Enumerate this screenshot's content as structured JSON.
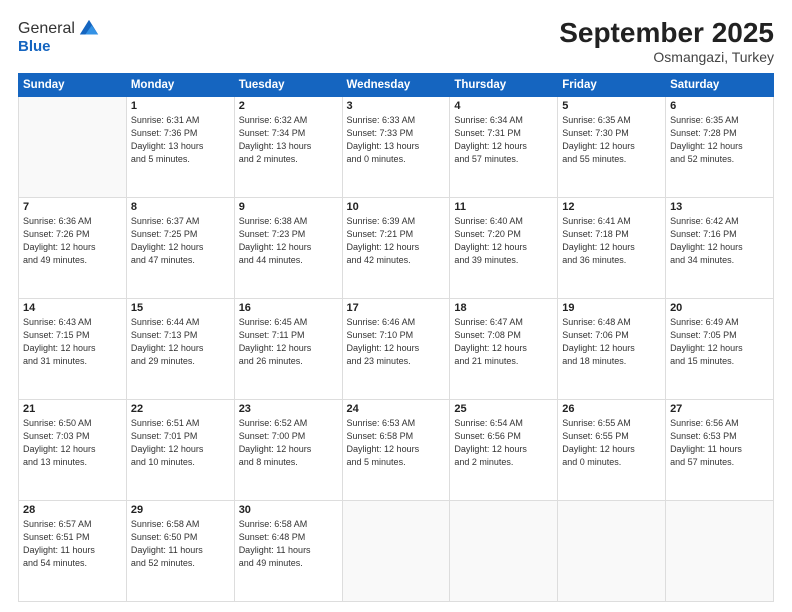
{
  "header": {
    "logo_line1": "General",
    "logo_line2": "Blue",
    "title": "September 2025",
    "subtitle": "Osmangazi, Turkey"
  },
  "days_of_week": [
    "Sunday",
    "Monday",
    "Tuesday",
    "Wednesday",
    "Thursday",
    "Friday",
    "Saturday"
  ],
  "weeks": [
    [
      {
        "day": "",
        "info": ""
      },
      {
        "day": "1",
        "info": "Sunrise: 6:31 AM\nSunset: 7:36 PM\nDaylight: 13 hours\nand 5 minutes."
      },
      {
        "day": "2",
        "info": "Sunrise: 6:32 AM\nSunset: 7:34 PM\nDaylight: 13 hours\nand 2 minutes."
      },
      {
        "day": "3",
        "info": "Sunrise: 6:33 AM\nSunset: 7:33 PM\nDaylight: 13 hours\nand 0 minutes."
      },
      {
        "day": "4",
        "info": "Sunrise: 6:34 AM\nSunset: 7:31 PM\nDaylight: 12 hours\nand 57 minutes."
      },
      {
        "day": "5",
        "info": "Sunrise: 6:35 AM\nSunset: 7:30 PM\nDaylight: 12 hours\nand 55 minutes."
      },
      {
        "day": "6",
        "info": "Sunrise: 6:35 AM\nSunset: 7:28 PM\nDaylight: 12 hours\nand 52 minutes."
      }
    ],
    [
      {
        "day": "7",
        "info": "Sunrise: 6:36 AM\nSunset: 7:26 PM\nDaylight: 12 hours\nand 49 minutes."
      },
      {
        "day": "8",
        "info": "Sunrise: 6:37 AM\nSunset: 7:25 PM\nDaylight: 12 hours\nand 47 minutes."
      },
      {
        "day": "9",
        "info": "Sunrise: 6:38 AM\nSunset: 7:23 PM\nDaylight: 12 hours\nand 44 minutes."
      },
      {
        "day": "10",
        "info": "Sunrise: 6:39 AM\nSunset: 7:21 PM\nDaylight: 12 hours\nand 42 minutes."
      },
      {
        "day": "11",
        "info": "Sunrise: 6:40 AM\nSunset: 7:20 PM\nDaylight: 12 hours\nand 39 minutes."
      },
      {
        "day": "12",
        "info": "Sunrise: 6:41 AM\nSunset: 7:18 PM\nDaylight: 12 hours\nand 36 minutes."
      },
      {
        "day": "13",
        "info": "Sunrise: 6:42 AM\nSunset: 7:16 PM\nDaylight: 12 hours\nand 34 minutes."
      }
    ],
    [
      {
        "day": "14",
        "info": "Sunrise: 6:43 AM\nSunset: 7:15 PM\nDaylight: 12 hours\nand 31 minutes."
      },
      {
        "day": "15",
        "info": "Sunrise: 6:44 AM\nSunset: 7:13 PM\nDaylight: 12 hours\nand 29 minutes."
      },
      {
        "day": "16",
        "info": "Sunrise: 6:45 AM\nSunset: 7:11 PM\nDaylight: 12 hours\nand 26 minutes."
      },
      {
        "day": "17",
        "info": "Sunrise: 6:46 AM\nSunset: 7:10 PM\nDaylight: 12 hours\nand 23 minutes."
      },
      {
        "day": "18",
        "info": "Sunrise: 6:47 AM\nSunset: 7:08 PM\nDaylight: 12 hours\nand 21 minutes."
      },
      {
        "day": "19",
        "info": "Sunrise: 6:48 AM\nSunset: 7:06 PM\nDaylight: 12 hours\nand 18 minutes."
      },
      {
        "day": "20",
        "info": "Sunrise: 6:49 AM\nSunset: 7:05 PM\nDaylight: 12 hours\nand 15 minutes."
      }
    ],
    [
      {
        "day": "21",
        "info": "Sunrise: 6:50 AM\nSunset: 7:03 PM\nDaylight: 12 hours\nand 13 minutes."
      },
      {
        "day": "22",
        "info": "Sunrise: 6:51 AM\nSunset: 7:01 PM\nDaylight: 12 hours\nand 10 minutes."
      },
      {
        "day": "23",
        "info": "Sunrise: 6:52 AM\nSunset: 7:00 PM\nDaylight: 12 hours\nand 8 minutes."
      },
      {
        "day": "24",
        "info": "Sunrise: 6:53 AM\nSunset: 6:58 PM\nDaylight: 12 hours\nand 5 minutes."
      },
      {
        "day": "25",
        "info": "Sunrise: 6:54 AM\nSunset: 6:56 PM\nDaylight: 12 hours\nand 2 minutes."
      },
      {
        "day": "26",
        "info": "Sunrise: 6:55 AM\nSunset: 6:55 PM\nDaylight: 12 hours\nand 0 minutes."
      },
      {
        "day": "27",
        "info": "Sunrise: 6:56 AM\nSunset: 6:53 PM\nDaylight: 11 hours\nand 57 minutes."
      }
    ],
    [
      {
        "day": "28",
        "info": "Sunrise: 6:57 AM\nSunset: 6:51 PM\nDaylight: 11 hours\nand 54 minutes."
      },
      {
        "day": "29",
        "info": "Sunrise: 6:58 AM\nSunset: 6:50 PM\nDaylight: 11 hours\nand 52 minutes."
      },
      {
        "day": "30",
        "info": "Sunrise: 6:58 AM\nSunset: 6:48 PM\nDaylight: 11 hours\nand 49 minutes."
      },
      {
        "day": "",
        "info": ""
      },
      {
        "day": "",
        "info": ""
      },
      {
        "day": "",
        "info": ""
      },
      {
        "day": "",
        "info": ""
      }
    ]
  ]
}
